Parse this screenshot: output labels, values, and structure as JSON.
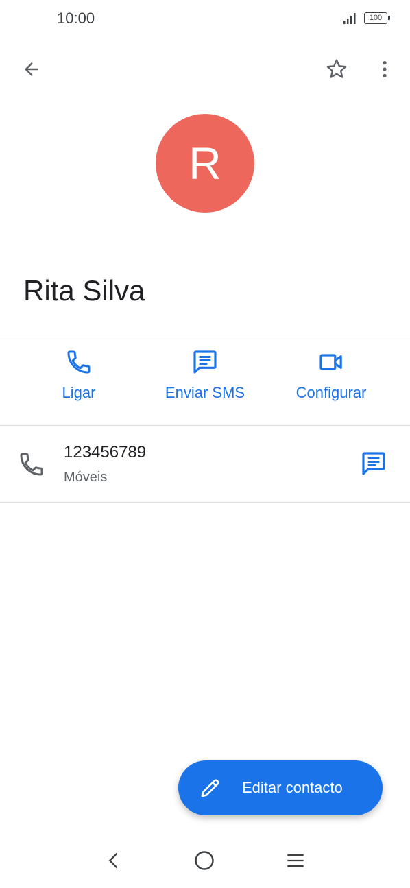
{
  "status_bar": {
    "time": "10:00",
    "battery": "100",
    "icons": [
      "signal-icon",
      "battery-icon"
    ]
  },
  "toolbar": {
    "icons": [
      "back-arrow-icon",
      "star-outline-icon",
      "more-vert-icon"
    ]
  },
  "contact": {
    "initial": "R",
    "name": "Rita Silva",
    "avatar_color": "#ee675c"
  },
  "actions": [
    {
      "label": "Ligar",
      "icon": "phone-icon"
    },
    {
      "label": "Enviar SMS",
      "icon": "message-icon"
    },
    {
      "label": "Configurar",
      "icon": "video-icon"
    }
  ],
  "phone_entry": {
    "number": "123456789",
    "type": "Móveis",
    "icons": [
      "phone-icon",
      "message-icon"
    ]
  },
  "fab": {
    "label": "Editar contacto",
    "icon": "pencil-icon"
  },
  "nav_bar": {
    "icons": [
      "nav-back-icon",
      "nav-home-icon",
      "nav-menu-icon"
    ]
  },
  "colors": {
    "accent": "#1a73e8",
    "text": "#202124",
    "secondary_text": "#5f6368",
    "divider": "#dadce0"
  }
}
